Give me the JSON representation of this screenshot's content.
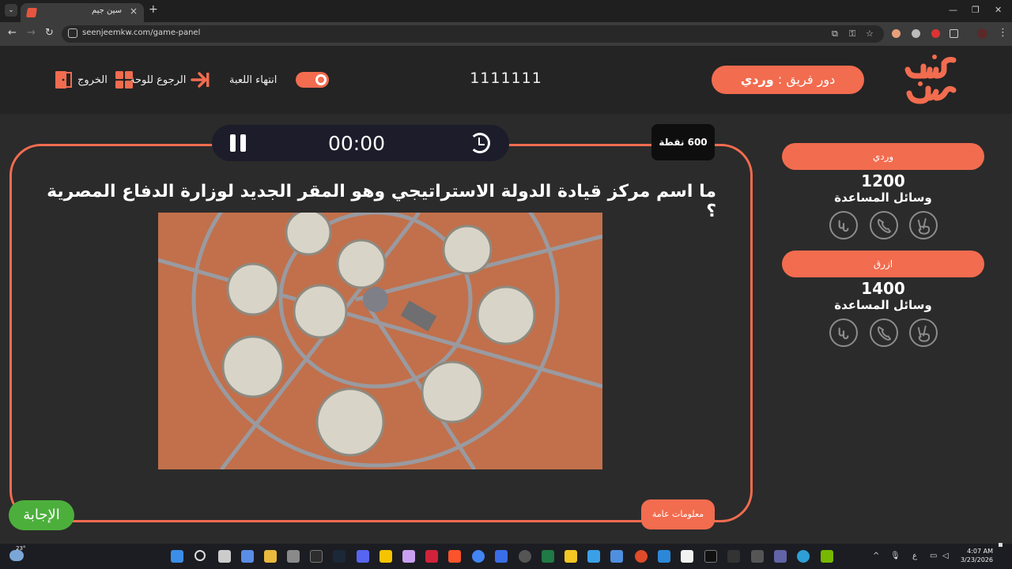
{
  "browser": {
    "tab_title": "سين جيم",
    "url": "seenjeemkw.com/game-panel"
  },
  "header": {
    "logo_text": "سين جيم",
    "turn_label": "دور فريق :",
    "turn_team": "وردي",
    "game_code": "1111111",
    "end_game_label": "انتهاء اللعبة",
    "back_to_board_label": "الرجوع للوحة",
    "exit_label": "الخروج"
  },
  "question_panel": {
    "timer": "00:00",
    "points": "600 نقطة",
    "question": "ما اسم مركز قيادة الدولة الاستراتيجي وهو المقر الجديد لوزارة الدفاع المصرية ؟",
    "category": "معلومات عامة",
    "answer_label": "الإجابة"
  },
  "teams": [
    {
      "name": "وردي",
      "score": "1200",
      "help_label": "وسائل المساعدة"
    },
    {
      "name": "ازرق",
      "score": "1400",
      "help_label": "وسائل المساعدة"
    }
  ],
  "taskbar": {
    "temperature": "23°",
    "time": "4:07 AM",
    "date": "3/23/2026",
    "lang": "ع"
  },
  "colors": {
    "accent": "#f26c4f",
    "answer": "#4caf3c",
    "header_bg": "#242424",
    "page_bg": "#2b2b2b"
  }
}
